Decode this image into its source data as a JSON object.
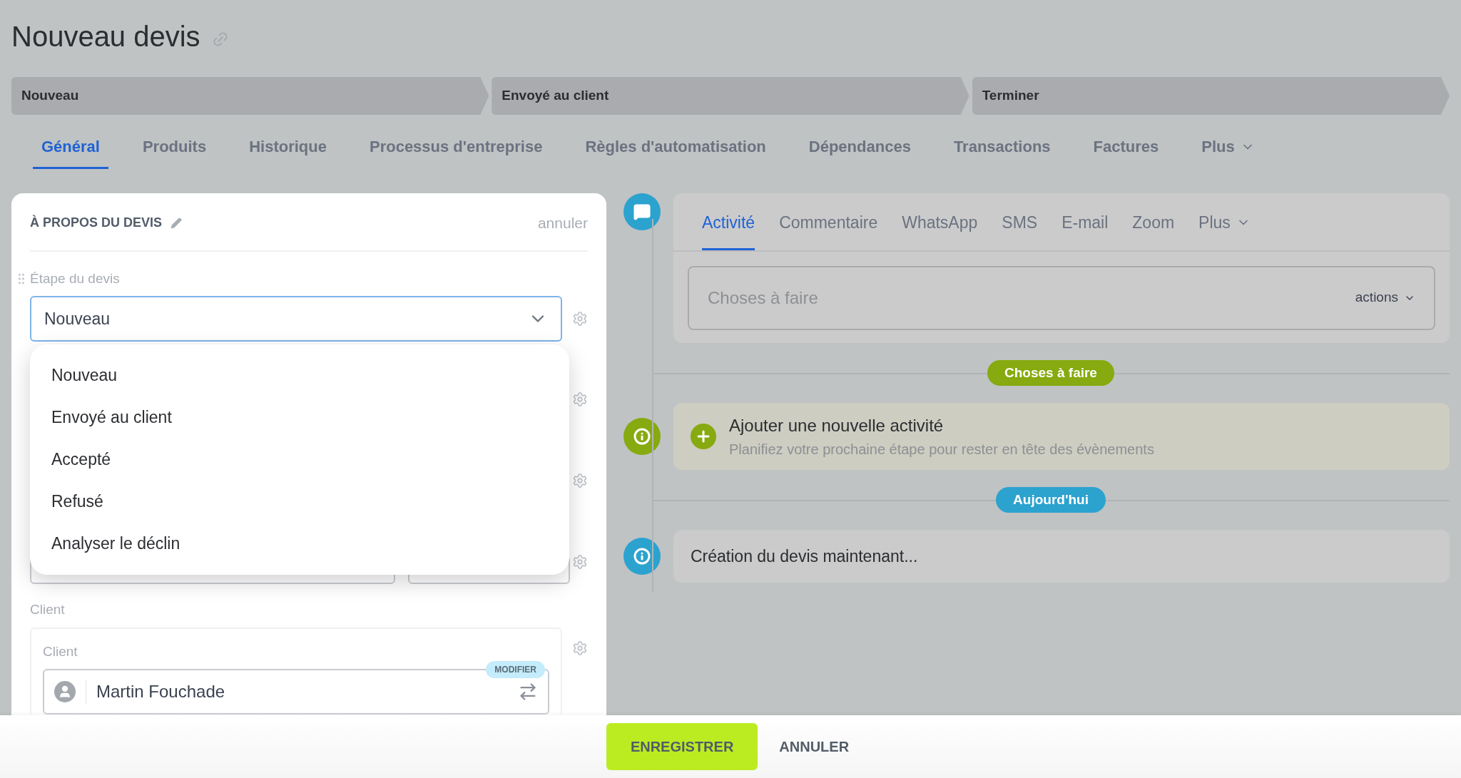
{
  "page": {
    "title": "Nouveau devis"
  },
  "stages": [
    {
      "label": "Nouveau"
    },
    {
      "label": "Envoyé au client"
    },
    {
      "label": "Terminer"
    }
  ],
  "tabs": [
    {
      "label": "Général",
      "selected": true,
      "kind": "tab"
    },
    {
      "label": "Produits",
      "selected": false,
      "kind": "tab"
    },
    {
      "label": "Historique",
      "selected": false,
      "kind": "tab"
    },
    {
      "label": "Processus d'entreprise",
      "selected": false,
      "kind": "tab"
    },
    {
      "label": "Règles d'automatisation",
      "selected": false,
      "kind": "tab"
    },
    {
      "label": "Dépendances",
      "selected": false,
      "kind": "tab"
    },
    {
      "label": "Transactions",
      "selected": false,
      "kind": "tab"
    },
    {
      "label": "Factures",
      "selected": false,
      "kind": "tab"
    },
    {
      "label": "Plus",
      "selected": false,
      "kind": "more"
    }
  ],
  "details": {
    "title": "À PROPOS DU DEVIS",
    "cancel": "annuler",
    "stage_field": {
      "label": "Étape du devis",
      "value": "Nouveau",
      "expanded": true,
      "options": [
        "Nouveau",
        "Envoyé au client",
        "Accepté",
        "Refusé",
        "Analyser le déclin"
      ]
    },
    "client_section": {
      "label": "Client",
      "field_label": "Client",
      "value": "Martin Fouchade",
      "badge": "MODIFIER"
    }
  },
  "activity": {
    "tabs": [
      {
        "label": "Activité",
        "selected": true,
        "kind": "tab"
      },
      {
        "label": "Commentaire",
        "selected": false,
        "kind": "tab"
      },
      {
        "label": "WhatsApp",
        "selected": false,
        "kind": "tab"
      },
      {
        "label": "SMS",
        "selected": false,
        "kind": "tab"
      },
      {
        "label": "E-mail",
        "selected": false,
        "kind": "tab"
      },
      {
        "label": "Zoom",
        "selected": false,
        "kind": "tab"
      },
      {
        "label": "Plus",
        "selected": false,
        "kind": "more"
      }
    ],
    "placeholder": "Choses à faire",
    "actions": "actions"
  },
  "timeline": [
    {
      "kind": "badge",
      "label": "Choses à faire",
      "color": "#86aa0f"
    },
    {
      "kind": "add",
      "title": "Ajouter une nouvelle activité",
      "subtitle": "Planifiez votre prochaine étape pour rester en tête des évènements",
      "color": "#86aa0f"
    },
    {
      "kind": "badge",
      "label": "Aujourd'hui",
      "color": "#2ca2cf"
    },
    {
      "kind": "event",
      "text": "Création du devis maintenant...",
      "color": "#2ca2cf"
    }
  ],
  "footer": [
    {
      "label": "ENREGISTRER",
      "kind": "primary"
    },
    {
      "label": "ANNULER",
      "kind": "link"
    }
  ]
}
